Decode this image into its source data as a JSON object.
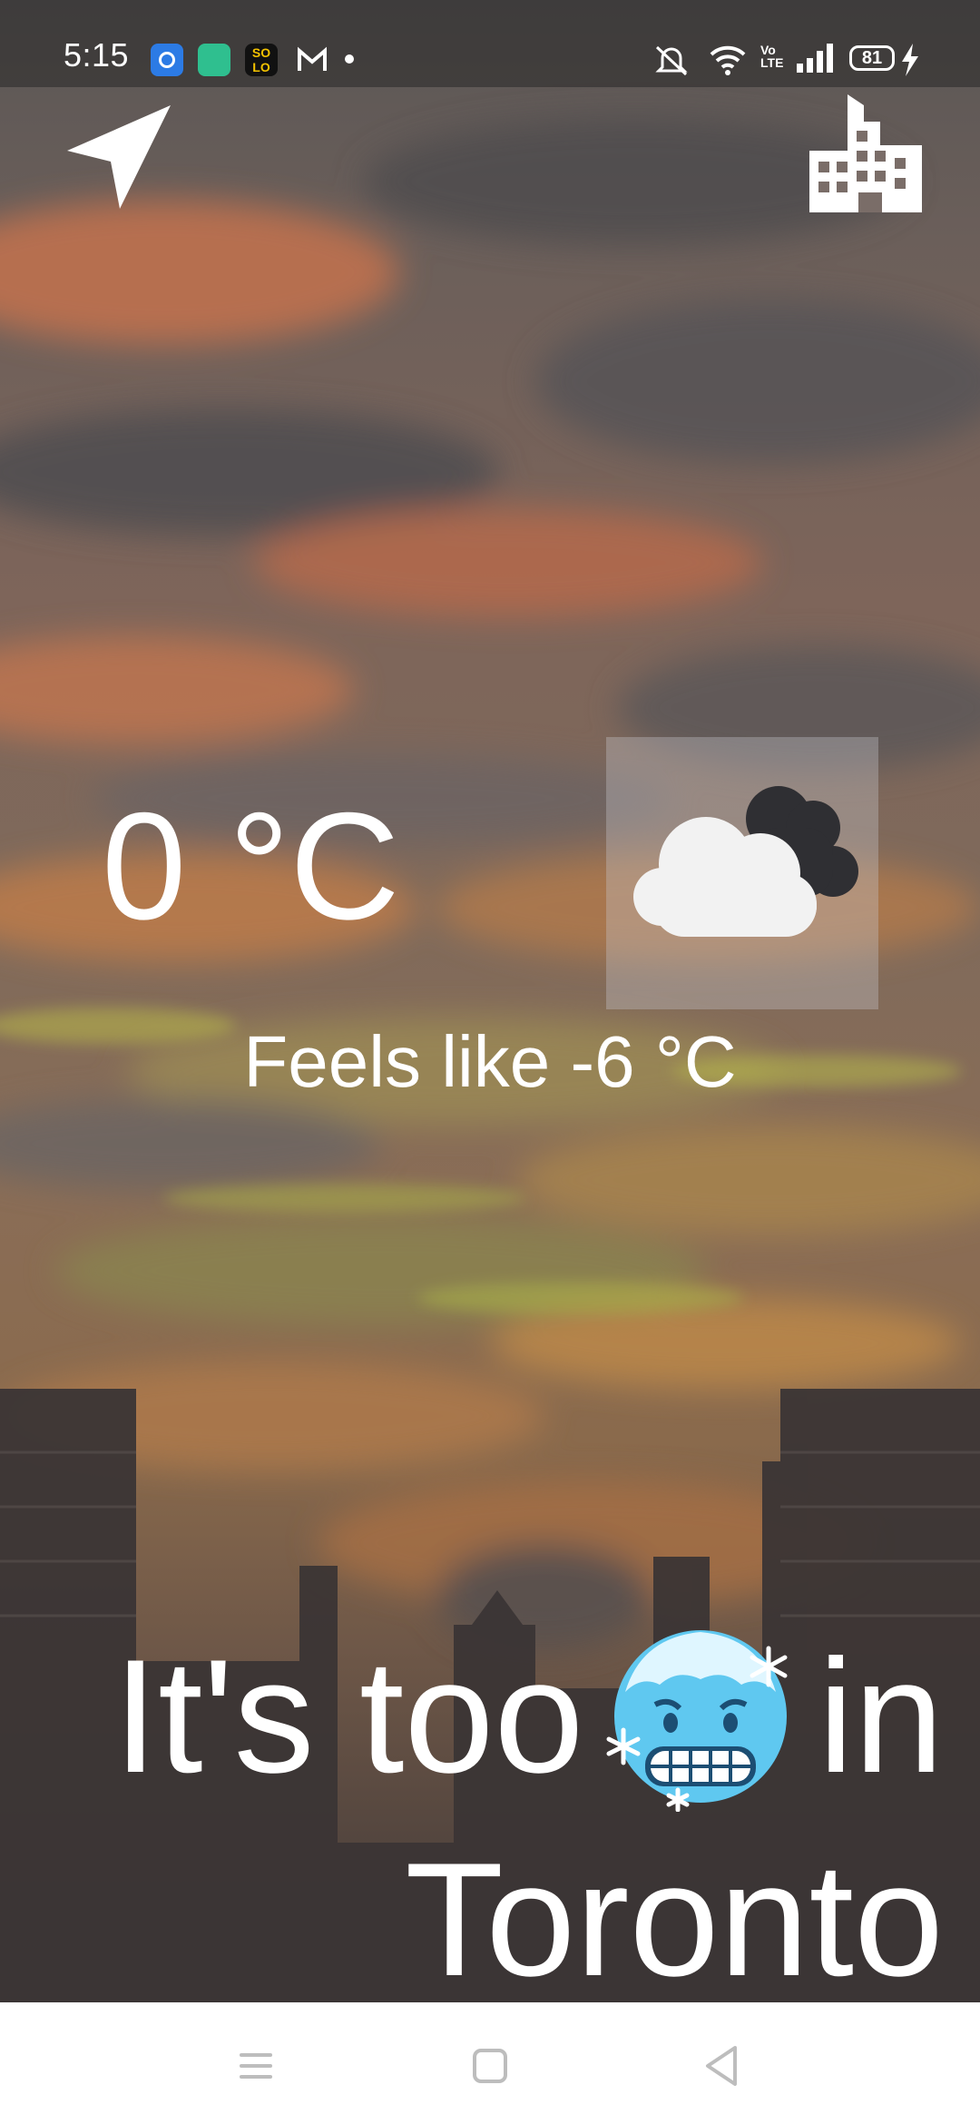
{
  "status_bar": {
    "time": "5:15",
    "battery": "81",
    "app_icons": [
      "blue-circle-app-icon",
      "green-app-icon",
      "solo-app-icon",
      "gmail-icon",
      "dot-indicator-icon"
    ],
    "system_icons": [
      "mute-icon",
      "wifi-icon",
      "volte-icon",
      "signal-icon",
      "battery-icon",
      "charging-icon"
    ]
  },
  "top_actions": {
    "location_icon": "navigation-arrow-icon",
    "city_icon": "city-buildings-icon"
  },
  "weather": {
    "temperature": "0 °C",
    "feels_like": "Feels like -6 °C",
    "condition_icon": "partly-cloudy-icon"
  },
  "headline": {
    "part1": "It's too",
    "emoji": "cold-face-emoji",
    "part2": "in",
    "city": "Toronto"
  },
  "nav_bar": {
    "buttons": [
      "recents-icon",
      "home-icon",
      "back-icon"
    ]
  },
  "colors": {
    "text": "#ffffff",
    "navbar_bg": "#ffffff",
    "navbar_icon": "#bdbdbd",
    "emoji_face": "#5fc8f0"
  }
}
